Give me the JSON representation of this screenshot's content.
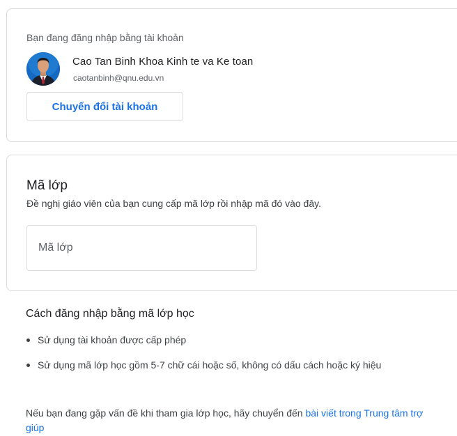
{
  "account": {
    "signed_in_label": "Bạn đang đăng nhập bằng tài khoản",
    "user_name": "Cao Tan Binh Khoa Kinh te va Ke toan",
    "user_email": "caotanbinh@qnu.edu.vn",
    "switch_button": "Chuyển đổi tài khoản"
  },
  "class_code": {
    "title": "Mã lớp",
    "description": "Đề nghị giáo viên của bạn cung cấp mã lớp rồi nhập mã đó vào đây.",
    "input_placeholder": "Mã lớp",
    "input_value": ""
  },
  "help": {
    "title": "Cách đăng nhập bằng mã lớp học",
    "bullets": [
      "Sử dụng tài khoản được cấp phép",
      "Sử dụng mã lớp học gồm 5-7 chữ cái hoặc số, không có dấu cách hoặc ký hiệu"
    ],
    "footer_text": "Nếu bạn đang gặp vấn đề khi tham gia lớp học, hãy chuyển đến ",
    "footer_link": "bài viết trong Trung tâm trợ giúp"
  },
  "colors": {
    "accent": "#1a73e8",
    "border": "#dadce0",
    "text_secondary": "#5f6368"
  },
  "icons": {
    "avatar": "user-avatar-photo"
  }
}
